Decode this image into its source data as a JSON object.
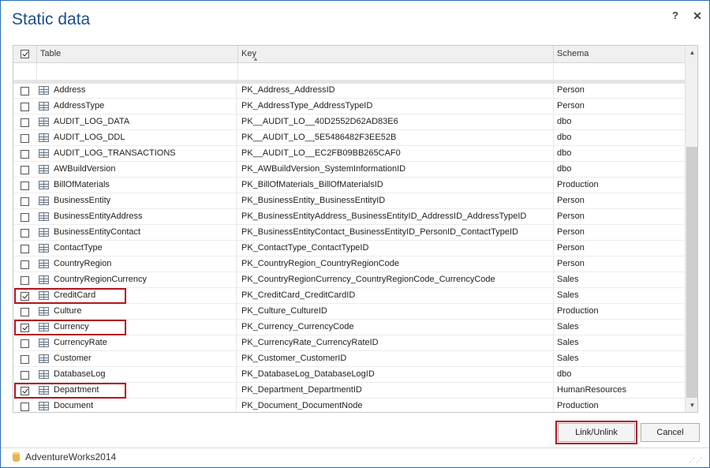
{
  "window": {
    "title": "Static data",
    "help_glyph": "?",
    "close_glyph": "✕"
  },
  "grid": {
    "columns": {
      "table": "Table",
      "key": "Key",
      "schema": "Schema"
    },
    "rows": [
      {
        "name": "Address",
        "key": "PK_Address_AddressID",
        "schema": "Person",
        "checked": false
      },
      {
        "name": "AddressType",
        "key": "PK_AddressType_AddressTypeID",
        "schema": "Person",
        "checked": false
      },
      {
        "name": "AUDIT_LOG_DATA",
        "key": "PK__AUDIT_LO__40D2552D62AD83E6",
        "schema": "dbo",
        "checked": false
      },
      {
        "name": "AUDIT_LOG_DDL",
        "key": "PK__AUDIT_LO__5E5486482F3EE52B",
        "schema": "dbo",
        "checked": false
      },
      {
        "name": "AUDIT_LOG_TRANSACTIONS",
        "key": "PK__AUDIT_LO__EC2FB09BB265CAF0",
        "schema": "dbo",
        "checked": false
      },
      {
        "name": "AWBuildVersion",
        "key": "PK_AWBuildVersion_SystemInformationID",
        "schema": "dbo",
        "checked": false
      },
      {
        "name": "BillOfMaterials",
        "key": "PK_BillOfMaterials_BillOfMaterialsID",
        "schema": "Production",
        "checked": false
      },
      {
        "name": "BusinessEntity",
        "key": "PK_BusinessEntity_BusinessEntityID",
        "schema": "Person",
        "checked": false
      },
      {
        "name": "BusinessEntityAddress",
        "key": "PK_BusinessEntityAddress_BusinessEntityID_AddressID_AddressTypeID",
        "schema": "Person",
        "checked": false
      },
      {
        "name": "BusinessEntityContact",
        "key": "PK_BusinessEntityContact_BusinessEntityID_PersonID_ContactTypeID",
        "schema": "Person",
        "checked": false
      },
      {
        "name": "ContactType",
        "key": "PK_ContactType_ContactTypeID",
        "schema": "Person",
        "checked": false
      },
      {
        "name": "CountryRegion",
        "key": "PK_CountryRegion_CountryRegionCode",
        "schema": "Person",
        "checked": false
      },
      {
        "name": "CountryRegionCurrency",
        "key": "PK_CountryRegionCurrency_CountryRegionCode_CurrencyCode",
        "schema": "Sales",
        "checked": false
      },
      {
        "name": "CreditCard",
        "key": "PK_CreditCard_CreditCardID",
        "schema": "Sales",
        "checked": true
      },
      {
        "name": "Culture",
        "key": "PK_Culture_CultureID",
        "schema": "Production",
        "checked": false
      },
      {
        "name": "Currency",
        "key": "PK_Currency_CurrencyCode",
        "schema": "Sales",
        "checked": true
      },
      {
        "name": "CurrencyRate",
        "key": "PK_CurrencyRate_CurrencyRateID",
        "schema": "Sales",
        "checked": false
      },
      {
        "name": "Customer",
        "key": "PK_Customer_CustomerID",
        "schema": "Sales",
        "checked": false
      },
      {
        "name": "DatabaseLog",
        "key": "PK_DatabaseLog_DatabaseLogID",
        "schema": "dbo",
        "checked": false
      },
      {
        "name": "Department",
        "key": "PK_Department_DepartmentID",
        "schema": "HumanResources",
        "checked": true
      },
      {
        "name": "Document",
        "key": "PK_Document_DocumentNode",
        "schema": "Production",
        "checked": false
      }
    ]
  },
  "buttons": {
    "link_unlink": "Link/Unlink",
    "cancel": "Cancel"
  },
  "status": {
    "database": "AdventureWorks2014"
  },
  "colors": {
    "title": "#1e4e8c",
    "highlight": "#b0161e",
    "border": "#2b6cb8"
  }
}
